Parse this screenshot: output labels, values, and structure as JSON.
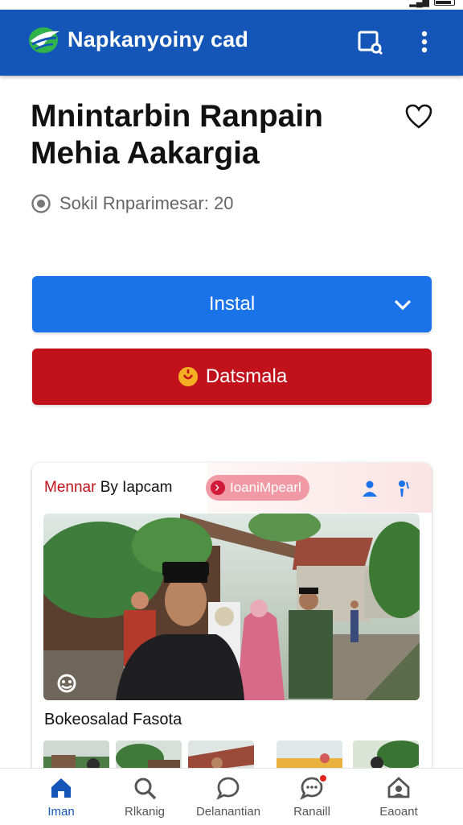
{
  "app_bar": {
    "title": "Napkanyoiny cad",
    "logo_icon": "globe-leaf-logo",
    "icons": [
      "cast-icon",
      "more-vert-icon"
    ]
  },
  "article": {
    "headline_line1": "Mnintarbin Ranpain",
    "headline_line2": "Mehia Aakargia",
    "meta_text": "Sokil  Rnparimesar: 20",
    "meta_icon": "radio-icon",
    "favorite_icon": "heart-icon"
  },
  "actions": {
    "install_label": "Instal",
    "install_color": "#1a73e8",
    "secondary_label": "Datsmala",
    "secondary_color": "#c1121c"
  },
  "card": {
    "title_accent": "Mennar",
    "title_rest": " By Iapcam",
    "chip_label": "IoaniMpearl",
    "caption": "Bokeosalad Fasota"
  },
  "bottom_nav": {
    "items": [
      {
        "label": "Iman",
        "icon": "home-icon"
      },
      {
        "label": "Rlkanig",
        "icon": "search-icon"
      },
      {
        "label": "Delanantian",
        "icon": "chat-icon"
      },
      {
        "label": "Ranaill",
        "icon": "message-icon"
      },
      {
        "label": "Eaoant",
        "icon": "profile-icon"
      }
    ]
  }
}
